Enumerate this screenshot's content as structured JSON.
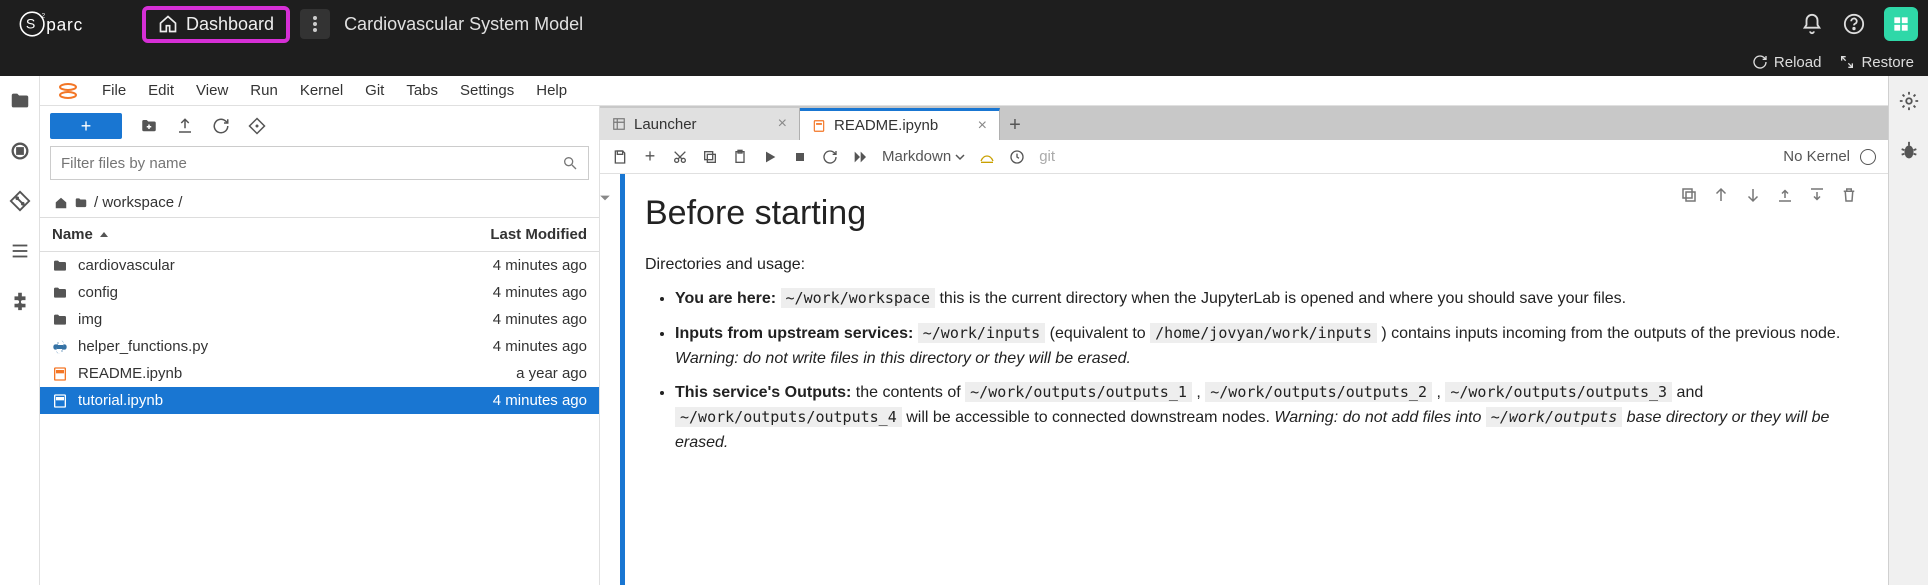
{
  "header": {
    "brand": "o²S²PARC",
    "dashboard": "Dashboard",
    "project_title": "Cardiovascular System Model",
    "reload": "Reload",
    "restore": "Restore"
  },
  "menu": {
    "items": [
      "File",
      "Edit",
      "View",
      "Run",
      "Kernel",
      "Git",
      "Tabs",
      "Settings",
      "Help"
    ]
  },
  "fb": {
    "filter_placeholder": "Filter files by name",
    "crumb": "/ workspace /",
    "head_name": "Name",
    "head_mod": "Last Modified",
    "rows": [
      {
        "icon": "folder",
        "name": "cardiovascular",
        "mod": "4 minutes ago"
      },
      {
        "icon": "folder",
        "name": "config",
        "mod": "4 minutes ago"
      },
      {
        "icon": "folder",
        "name": "img",
        "mod": "4 minutes ago"
      },
      {
        "icon": "py",
        "name": "helper_functions.py",
        "mod": "4 minutes ago"
      },
      {
        "icon": "nb",
        "name": "README.ipynb",
        "mod": "a year ago"
      },
      {
        "icon": "nb",
        "name": "tutorial.ipynb",
        "mod": "4 minutes ago",
        "selected": true
      }
    ]
  },
  "tabs": {
    "launcher": "Launcher",
    "readme": "README.ipynb"
  },
  "nb_toolbar": {
    "celltype": "Markdown",
    "git": "git",
    "kernel": "No Kernel"
  },
  "doc": {
    "h1": "Before starting",
    "intro": "Directories and usage:",
    "li1_bold": "You are here:",
    "li1_code": "~/work/workspace",
    "li1_rest": " this is the current directory when the JupyterLab is opened and where you should save your files.",
    "li2_bold": "Inputs from upstream services:",
    "li2_code1": "~/work/inputs",
    "li2_mid": " (equivalent to ",
    "li2_code2": "/home/jovyan/work/inputs",
    "li2_rest": " ) contains inputs incoming from the outputs of the previous node. ",
    "li2_warn": "Warning: do not write files in this directory or they will be erased.",
    "li3_bold": "This service's Outputs:",
    "li3_pre": " the contents of ",
    "li3_c1": "~/work/outputs/outputs_1",
    "li3_c2": "~/work/outputs/outputs_2",
    "li3_c3": "~/work/outputs/outputs_3",
    "li3_and": " and ",
    "li3_c4": "~/work/outputs/outputs_4",
    "li3_rest": " will be accessible to connected downstream nodes. ",
    "li3_warn": "Warning: do not add files into ",
    "li3_wcode": "~/work/outputs",
    "li3_wrest": " base directory or they will be erased."
  }
}
